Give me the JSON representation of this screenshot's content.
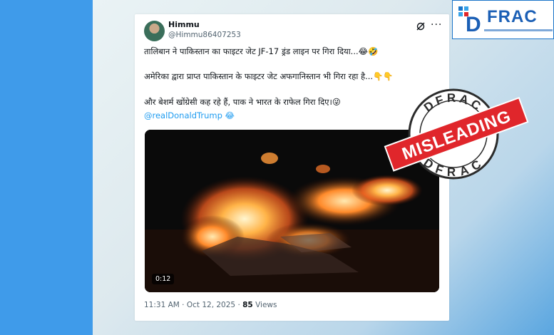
{
  "tweet": {
    "name": "Himmu",
    "handle": "@Himmu86407253",
    "line1": "तालिबान ने पाकिस्तान का फाइटर जेट JF-17 ड्रंड लाइन पर गिरा दिया...😂🤣",
    "line2": "अमेरिका द्वारा प्राप्त पाकिस्तान के फाइटर जेट अफगानिस्तान भी गिरा रहा है...👇👇",
    "line3": "और बेशर्म खोंग्रेसी कह रहे हैं, पाक ने भारत के राफेल गिरा दिए।😜",
    "mention": "@realDonaldTrump 😂",
    "video_duration": "0:12",
    "time": "11:31 AM · Oct 12, 2025 · ",
    "views_count": "85",
    "views_label": " Views"
  },
  "logo": {
    "text": "FRAC",
    "icon_letter": "D"
  },
  "stamp": {
    "label": "MISLEADING",
    "ring_top": "DFRAC",
    "ring_bottom": "DFRAC",
    "color": "#e0262b"
  },
  "icons": {
    "more": "more-icon",
    "grok": "grok-icon"
  }
}
